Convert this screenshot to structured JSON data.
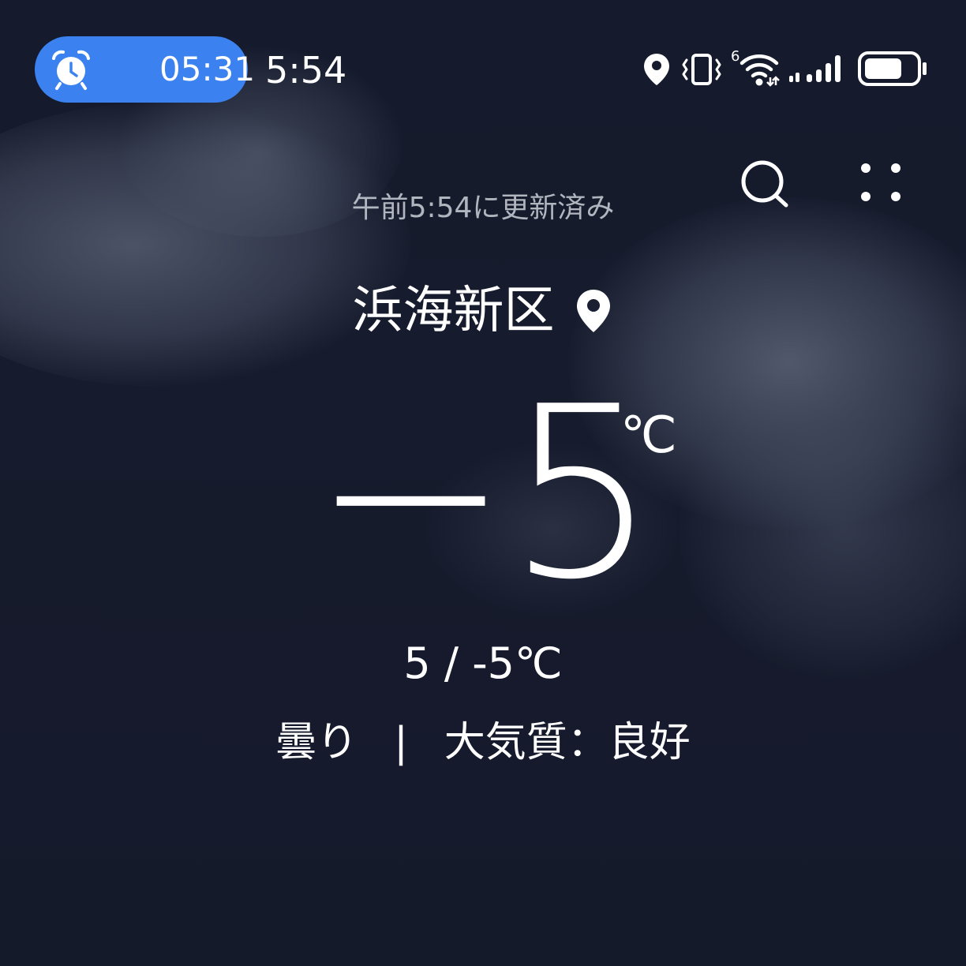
{
  "status_bar": {
    "alarm_time": "05:31",
    "clock": "5:54",
    "network_type": "6",
    "alarm_pill_color": "#3b82f0",
    "icons": [
      "alarm-clock-icon",
      "location-icon",
      "vibrate-icon",
      "wifi-icon",
      "cellular-signal-icon",
      "battery-icon"
    ]
  },
  "header": {
    "updated_text": "午前5:54に更新済み"
  },
  "location": {
    "name": "浜海新区"
  },
  "weather": {
    "temperature": "−5",
    "unit": "℃",
    "range": "5 / -5℃",
    "condition": "曇り",
    "separator": "|",
    "air_quality": "大気質：良好"
  }
}
